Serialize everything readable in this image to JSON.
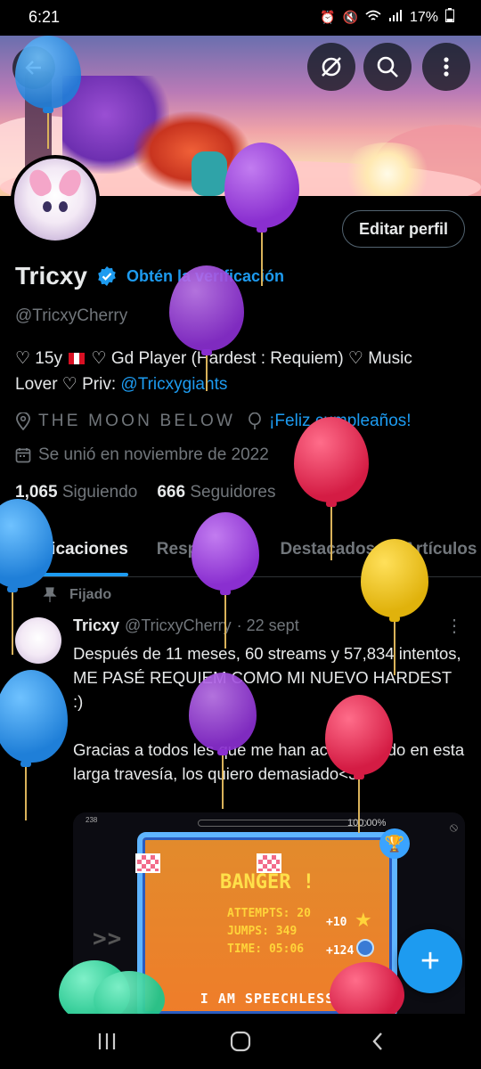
{
  "status": {
    "time": "6:21",
    "battery": "17%"
  },
  "banner": {},
  "profile": {
    "edit_label": "Editar perfil",
    "name": "Tricxy",
    "verify_label": "Obtén la verificación",
    "handle": "@TricxyCherry",
    "bio_line1": "♡ 15y",
    "bio_line1b": "♡ Gd Player (Hardest : Requiem) ♡ Music",
    "bio_line2": "Lover ♡ Priv: ",
    "bio_link": "@Tricxygiants",
    "location": "THE MOON BELOW",
    "birthday": "¡Feliz cumpleaños!",
    "joined": "Se unió en noviembre de 2022",
    "following_count": "1,065",
    "following_label": "Siguiendo",
    "followers_count": "666",
    "followers_label": "Seguidores"
  },
  "tabs": [
    "Publicaciones",
    "Respuestas",
    "Destacados",
    "Artículos"
  ],
  "post": {
    "pinned_label": "Fijado",
    "author": "Tricxy",
    "handle": "@TricxyCherry",
    "date": "· 22 sept",
    "text": "Después de 11 meses, 60 streams y 57,834 intentos, ME PASÉ REQUIEM COMO MI NUEVO HARDEST :)\n\nGracias a todos les que me han acompañado en esta larga travesía, los quiero demasiado<3"
  },
  "game": {
    "percent": "100.00%",
    "exit": ">> EXIT >>",
    "title": "BANGER !",
    "attempts": "ATTEMPTS: 20",
    "jumps": "JUMPS: 349",
    "time": "TIME: 05:06",
    "bonus1": "+10",
    "bonus2": "+124",
    "message": "I AM SPEECHLESS",
    "counter": "238"
  },
  "fab_label": "+",
  "colors": {
    "accent": "#1d9bf0",
    "background": "#000000",
    "muted": "#71767b"
  }
}
